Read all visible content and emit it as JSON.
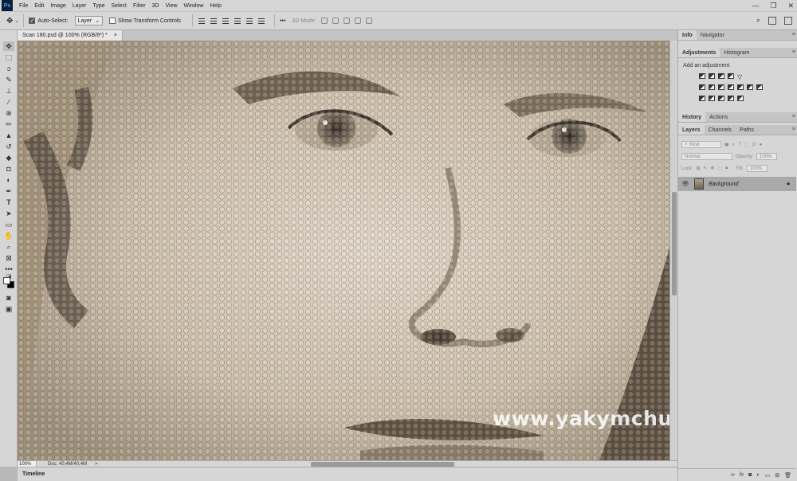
{
  "menubar": {
    "logo": "Ps",
    "items": [
      "File",
      "Edit",
      "Image",
      "Layer",
      "Type",
      "Select",
      "Filter",
      "3D",
      "View",
      "Window",
      "Help"
    ],
    "controls": [
      "—",
      "❐",
      "✕"
    ]
  },
  "options": {
    "auto_select_label": "Auto-Select:",
    "auto_select_checked": true,
    "target_value": "Layer",
    "show_transform_label": "Show Transform Controls",
    "show_transform_checked": false,
    "more_glyph": "•••",
    "mode_3d_label": "3D Mode:"
  },
  "document": {
    "tab_title": "Scan 180.psd @ 100% (RGB/8*) *",
    "tab_close": "×",
    "zoom": "100%",
    "doc_info": "Doc: 40,4M/40,4M",
    "status_arrow": ">",
    "watermark": "www.yakymchuk.net"
  },
  "timeline": {
    "label": "Timeline"
  },
  "panels": {
    "info_tabs": [
      "Info",
      "Navigator"
    ],
    "adj_tabs": [
      "Adjustments",
      "Histogram"
    ],
    "adj_title": "Add an adjustment",
    "history_tabs": [
      "History",
      "Actions"
    ],
    "layer_tabs": [
      "Layers",
      "Channels",
      "Paths"
    ],
    "kind_label": "Kind",
    "blend_mode": "Normal",
    "opacity_label": "Opacity:",
    "opacity_value": "100%",
    "lock_label": "Lock:",
    "fill_label": "Fill:",
    "fill_value": "100%",
    "layer": {
      "name": "Background",
      "visible": true,
      "locked": true
    },
    "menu_glyph": "≡",
    "collapse_glyph": "»",
    "bottom_icons": [
      "link-icon",
      "fx-icon",
      "mask-icon",
      "adjustment-icon",
      "folder-icon",
      "new-layer-icon",
      "trash-icon"
    ]
  },
  "tools": [
    "move-tool",
    "marquee-tool",
    "lasso-tool",
    "quick-select-tool",
    "crop-tool",
    "eyedropper-tool",
    "healing-tool",
    "brush-tool",
    "clone-stamp-tool",
    "history-brush-tool",
    "eraser-tool",
    "gradient-tool",
    "dodge-tool",
    "pen-tool",
    "type-tool",
    "path-select-tool",
    "rectangle-tool",
    "hand-tool",
    "zoom-tool",
    "frame-tool",
    "more-tools",
    "default-colors",
    "color-swatches",
    "quick-mask",
    "screen-mode"
  ],
  "colors": {
    "ui_bg": "#d6d6d6",
    "selected_layer": "#a9a9a9",
    "sepia_light": "#d8ccbb",
    "sepia_dark": "#5a4e40"
  }
}
